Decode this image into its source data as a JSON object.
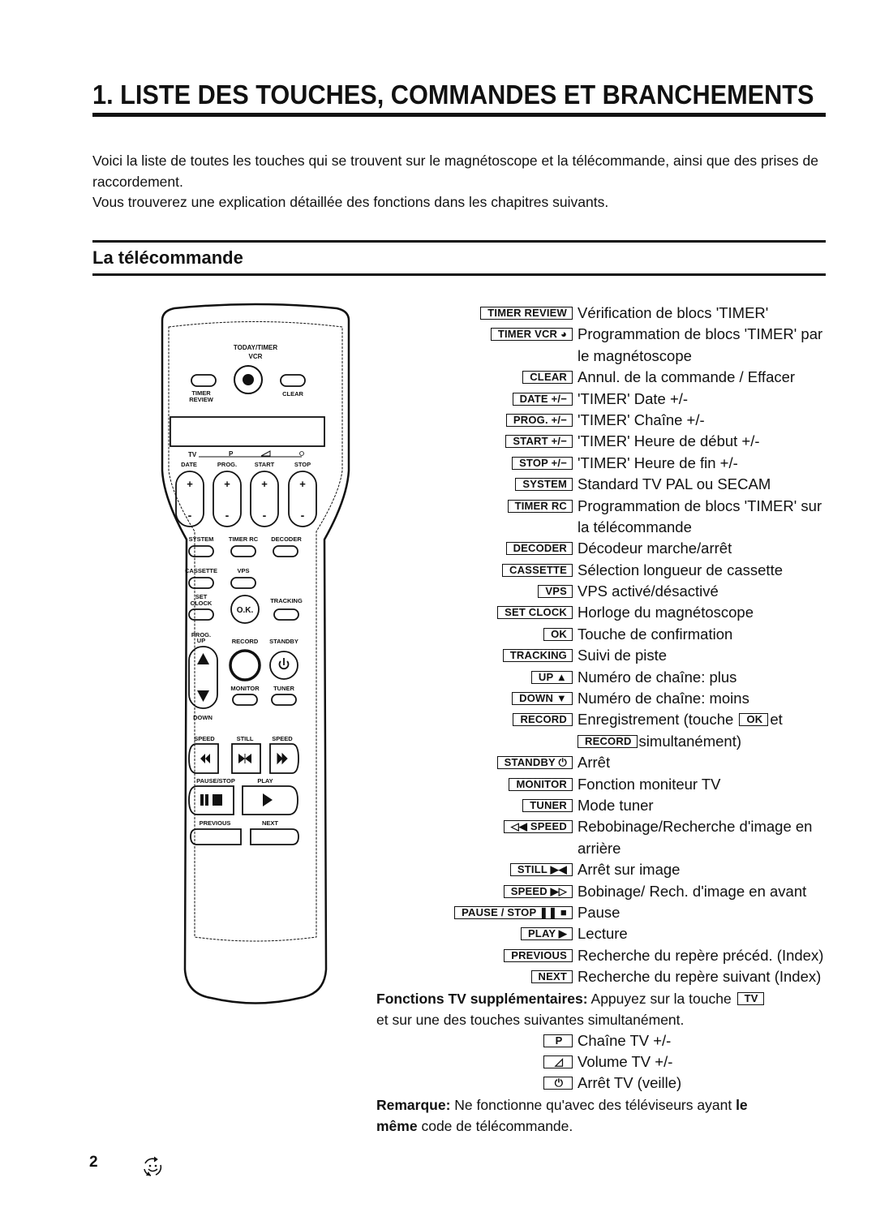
{
  "page": {
    "title": "1.  LISTE DES TOUCHES, COMMANDES ET BRANCHEMENTS",
    "intro": [
      "Voici la liste de toutes les touches qui se trouvent sur le magnétoscope et la télécommande, ainsi que des prises de raccordement.",
      "Vous trouverez une explication détaillée des fonctions dans les chapitres suivants."
    ],
    "section_title": "La télécommande",
    "page_number": "2",
    "footer_icon": "recycle-smiley-icon"
  },
  "remote": {
    "labels": {
      "today_timer": "TODAY/TIMER",
      "vcr": "VCR",
      "timer": "TIMER",
      "review": "REVIEW",
      "clear": "CLEAR",
      "tv": "TV",
      "p": "P",
      "date": "DATE",
      "prog": "PROG.",
      "start": "START",
      "stop": "STOP",
      "plus": "+",
      "minus": "-",
      "system": "SYSTEM",
      "timer_rc": "TIMER RC",
      "decoder": "DECODER",
      "cassette": "CASSETTE",
      "vps": "VPS",
      "set": "SET",
      "clock": "CLOCK",
      "ok": "O.K.",
      "tracking": "TRACKING",
      "prog_up_1": "PROG.",
      "prog_up_2": "UP",
      "record": "RECORD",
      "standby": "STANDBY",
      "monitor": "MONITOR",
      "tuner": "TUNER",
      "down": "DOWN",
      "speed_rew": "SPEED",
      "still": "STILL",
      "speed_ff": "SPEED",
      "pause_stop": "PAUSE/STOP",
      "play": "PLAY",
      "previous": "PREVIOUS",
      "next": "NEXT"
    }
  },
  "keys": [
    {
      "key": "TIMER  REVIEW",
      "desc": "Vérification de blocs 'TIMER'"
    },
    {
      "key": "TIMER  VCR ◕",
      "desc": "Programmation de blocs 'TIMER' par",
      "cont": "le magnétoscope"
    },
    {
      "key": "CLEAR",
      "desc": "Annul. de la commande / Effacer"
    },
    {
      "key": "DATE  +/−",
      "desc": "'TIMER' Date +/-"
    },
    {
      "key": "PROG.  +/−",
      "desc": "'TIMER' Chaîne +/-"
    },
    {
      "key": "START  +/−",
      "desc": "'TIMER' Heure de début +/-"
    },
    {
      "key": "STOP  +/−",
      "desc": "'TIMER' Heure de fin +/-"
    },
    {
      "key": "SYSTEM",
      "desc": "Standard TV PAL ou SECAM"
    },
    {
      "key": "TIMER  RC",
      "desc": "Programmation de blocs 'TIMER' sur",
      "cont": "la télécommande"
    },
    {
      "key": "DECODER",
      "desc": "Décodeur marche/arrêt"
    },
    {
      "key": "CASSETTE",
      "desc": "Sélection longueur de cassette"
    },
    {
      "key": "VPS",
      "desc": "VPS activé/désactivé"
    },
    {
      "key": "SET  CLOCK",
      "desc": "Horloge du magnétoscope"
    },
    {
      "key": "OK",
      "desc": "Touche de confirmation"
    },
    {
      "key": "TRACKING",
      "desc": "Suivi de piste"
    },
    {
      "key": "UP ▲",
      "desc": "Numéro de chaîne: plus"
    },
    {
      "key": "DOWN ▼",
      "desc": "Numéro de chaîne: moins"
    },
    {
      "key": "RECORD",
      "desc_before": "Enregistrement (touche",
      "inline_key": "OK",
      "desc_after": "et",
      "cont_key": "RECORD",
      "cont": "simultanément)"
    },
    {
      "key": "STANDBY  ⏻",
      "desc": "Arrêt"
    },
    {
      "key": "MONITOR",
      "desc": "Fonction moniteur TV"
    },
    {
      "key": "TUNER",
      "desc": "Mode tuner"
    },
    {
      "key": "◁◀  SPEED",
      "desc": "Rebobinage/Recherche d'image en",
      "cont": "arrière"
    },
    {
      "key": "STILL ▶◀",
      "desc": "Arrêt sur image"
    },
    {
      "key": "SPEED ▶▷",
      "desc": "Bobinage/ Rech. d'image en avant"
    },
    {
      "key": "PAUSE / STOP ❚❚ ■",
      "desc": "Pause"
    },
    {
      "key": "PLAY ▶",
      "desc": "Lecture"
    },
    {
      "key": "PREVIOUS",
      "desc": "Recherche du repère précéd. (Index)"
    },
    {
      "key": "NEXT",
      "desc": "Recherche du repère suivant (Index)"
    }
  ],
  "tv_functions": {
    "heading": "Fonctions TV supplémentaires:",
    "text1": "Appuyez sur la touche",
    "tv_key": "TV",
    "text2": "et sur une des touches suivantes simultanément.",
    "items": [
      {
        "key": "P",
        "desc": "Chaîne TV +/-"
      },
      {
        "key": "◿",
        "desc": "Volume TV +/-"
      },
      {
        "key": "⏻",
        "desc": "Arrêt TV (veille)"
      }
    ]
  },
  "remark": {
    "label": "Remarque:",
    "text": "Ne fonctionne qu'avec des téléviseurs ayant",
    "bold_tail_1": "le",
    "bold_head_2": "même",
    "text2": "code de télécommande."
  }
}
